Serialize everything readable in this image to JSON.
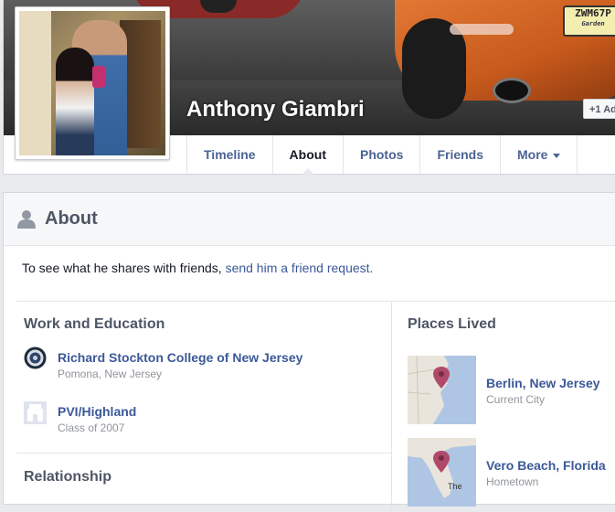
{
  "profile": {
    "name": "Anthony Giambri",
    "add_button": "+1 Ad",
    "plate_text": "ZWM67P",
    "plate_state": "Garden"
  },
  "nav": {
    "tabs": [
      {
        "label": "Timeline"
      },
      {
        "label": "About"
      },
      {
        "label": "Photos"
      },
      {
        "label": "Friends"
      },
      {
        "label": "More"
      }
    ]
  },
  "about": {
    "title": "About",
    "note_prefix": "To see what he shares with friends, ",
    "note_link": "send him a friend request."
  },
  "work_education": {
    "title": "Work and Education",
    "items": [
      {
        "name": "Richard Stockton College of New Jersey",
        "detail": "Pomona, New Jersey",
        "icon": "college-logo-icon"
      },
      {
        "name": "PVI/Highland",
        "detail": "Class of 2007",
        "icon": "school-placeholder-icon"
      }
    ]
  },
  "relationship": {
    "title": "Relationship"
  },
  "places": {
    "title": "Places Lived",
    "items": [
      {
        "name": "Berlin, New Jersey",
        "detail": "Current City",
        "icon": "map-pin-icon"
      },
      {
        "name": "Vero Beach, Florida",
        "detail": "Hometown",
        "icon": "map-pin-icon",
        "map_label": "The"
      }
    ]
  },
  "colors": {
    "link": "#3b5998",
    "muted": "#90949c",
    "background": "#e9eaed",
    "pin": "#b04a6a"
  }
}
